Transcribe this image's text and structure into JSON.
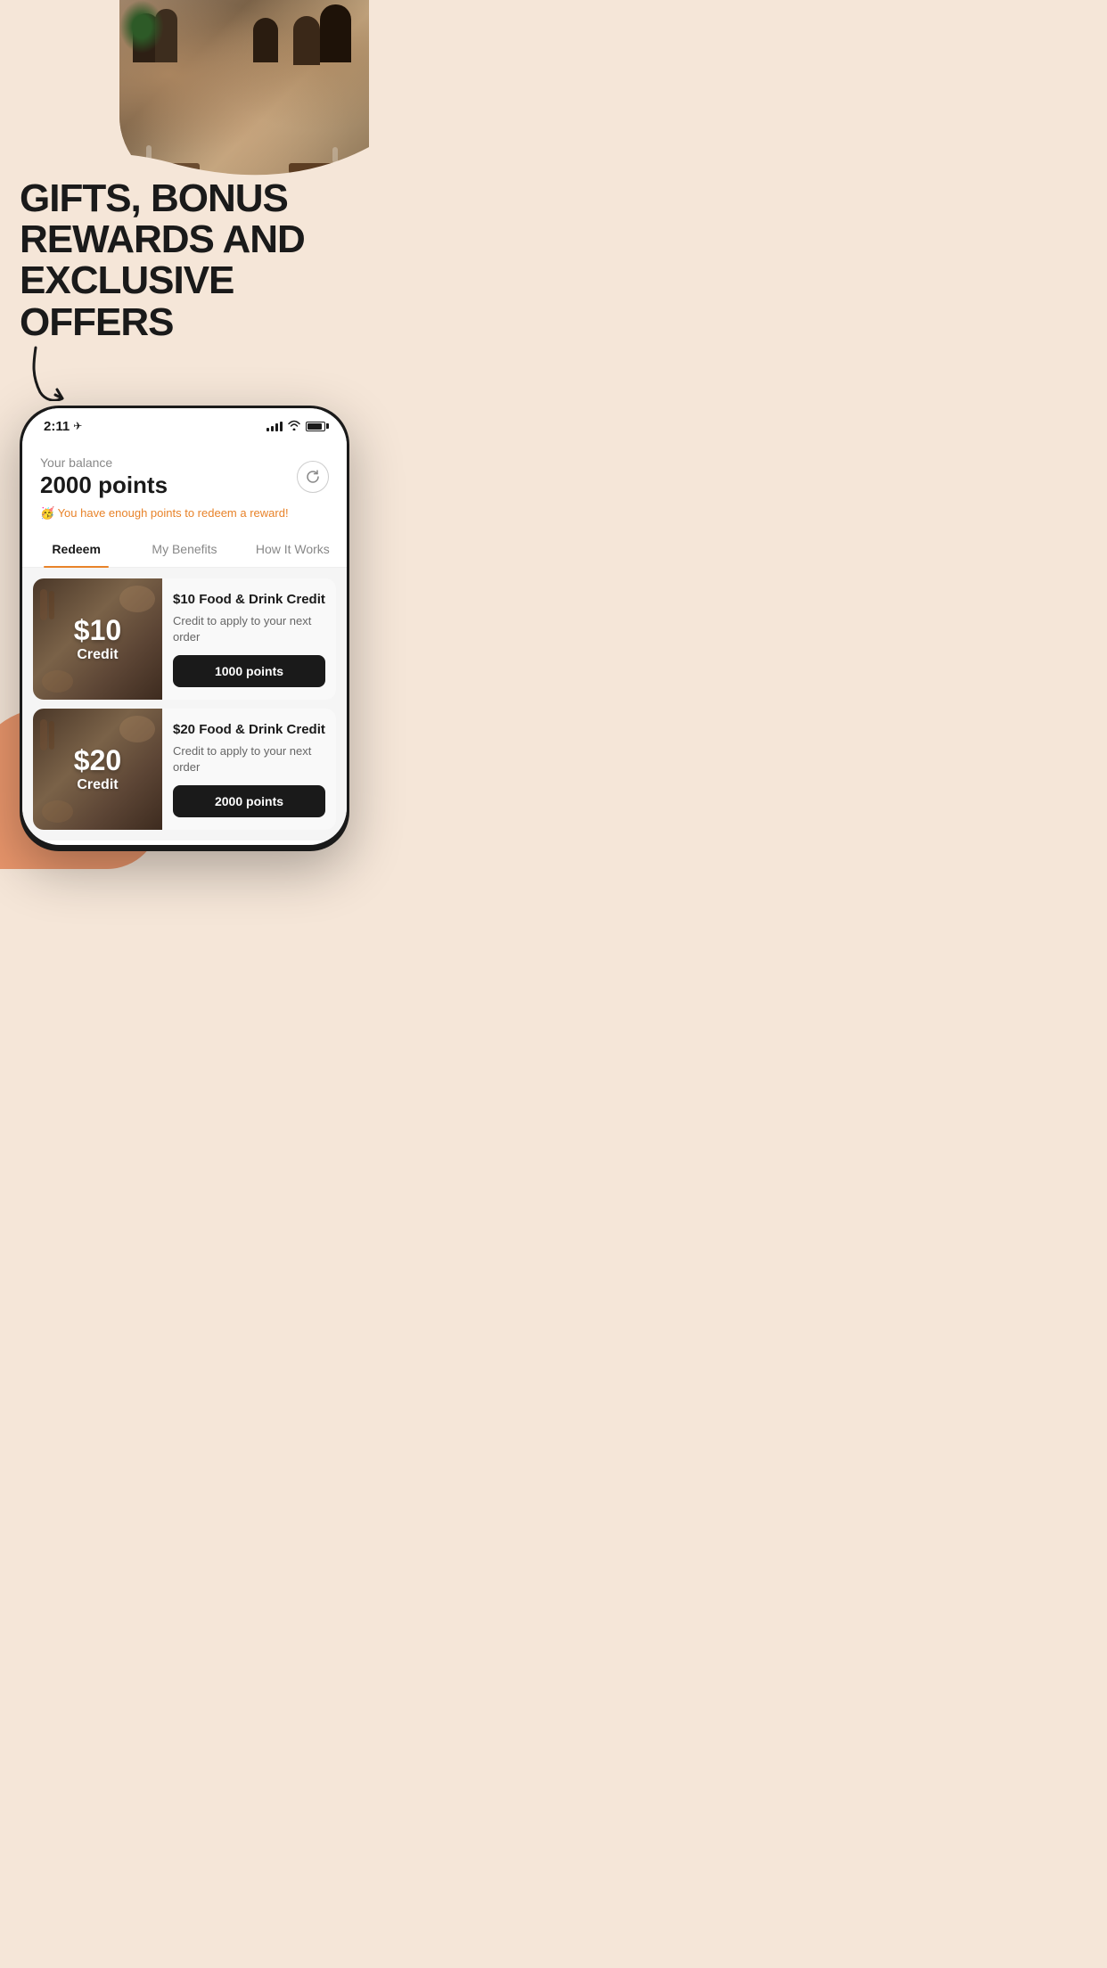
{
  "hero": {
    "alt": "Restaurant outdoor dining scene"
  },
  "headline": {
    "line1": "GIFTS, BONUS",
    "line2": "REWARDS AND",
    "line3": "EXCLUSIVE OFFERS"
  },
  "phone": {
    "status_bar": {
      "time": "2:11",
      "location_icon": "◁"
    },
    "balance": {
      "label": "Your balance",
      "amount": "2000 points",
      "notice_emoji": "🥳",
      "notice_text": "You have enough points to redeem a reward!"
    },
    "tabs": [
      {
        "label": "Redeem",
        "active": true
      },
      {
        "label": "My Benefits",
        "active": false
      },
      {
        "label": "How It Works",
        "active": false
      }
    ],
    "rewards": [
      {
        "amount": "$10",
        "type": "Credit",
        "title": "$10 Food & Drink Credit",
        "description": "Credit to apply to your next order",
        "points": "1000 points"
      },
      {
        "amount": "$20",
        "type": "Credit",
        "title": "$20 Food & Drink Credit",
        "description": "Credit to apply to your next order",
        "points": "2000 points"
      }
    ]
  },
  "colors": {
    "background": "#f5e6d8",
    "accent_orange": "#e8832a",
    "blob_orange": "#e8956b",
    "dark": "#1a1a1a",
    "active_tab_underline": "#e8832a"
  }
}
